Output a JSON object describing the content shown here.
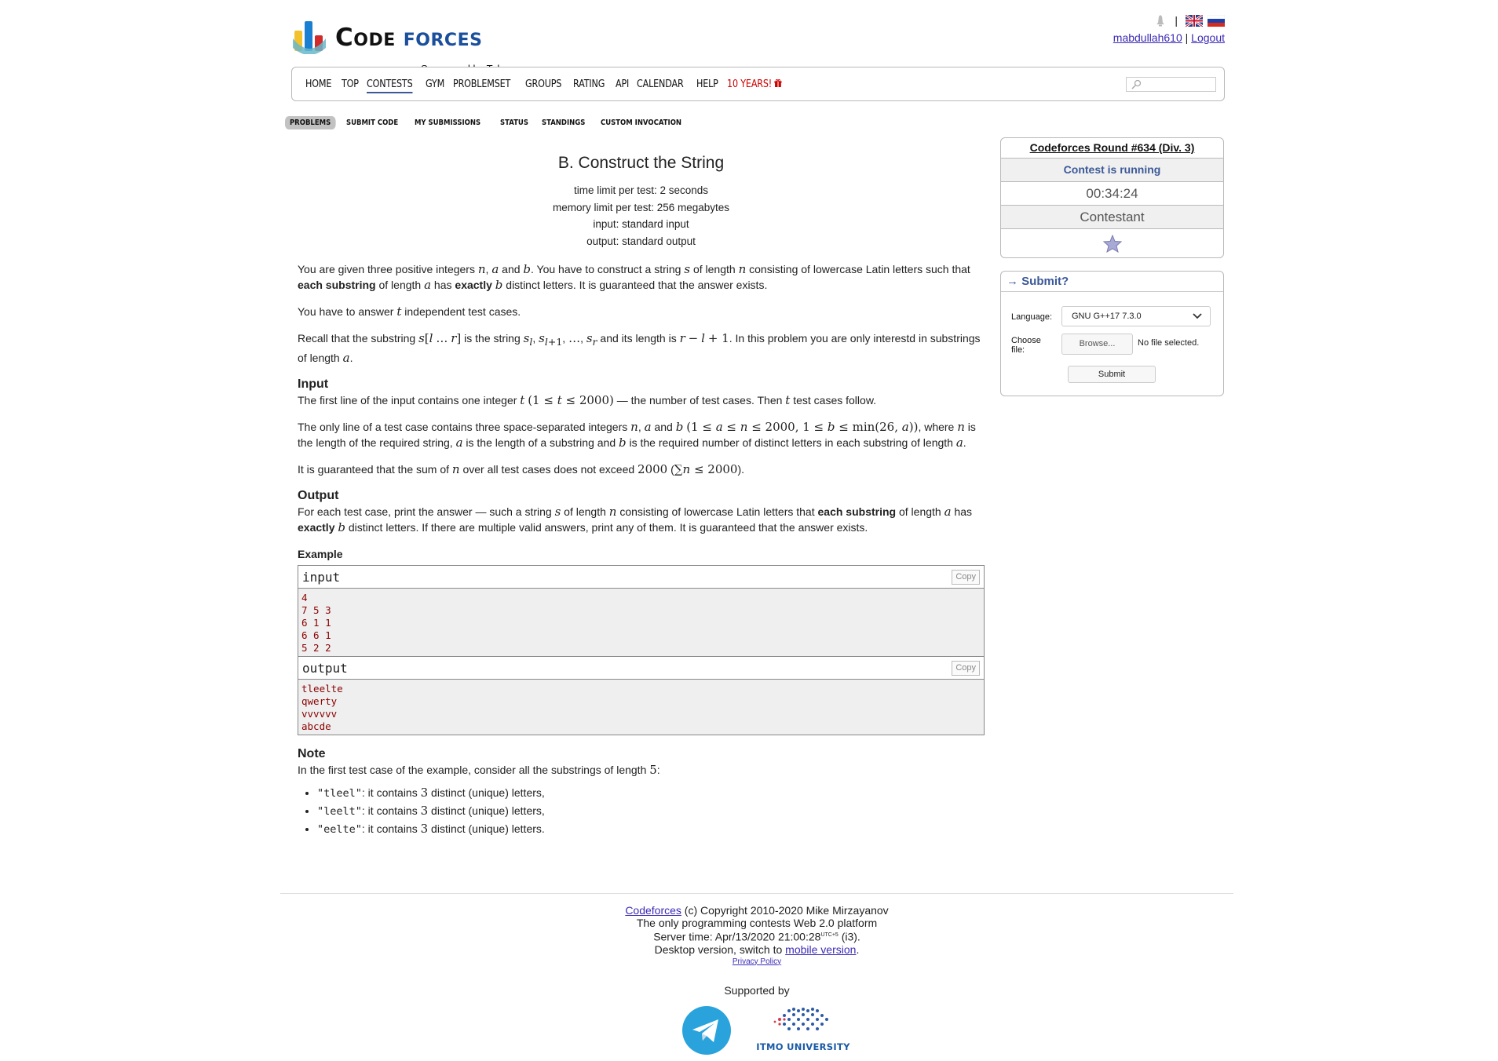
{
  "header": {
    "logo_word1": "Code",
    "logo_word2": "forces",
    "sponsor": "Sponsored by Telegram",
    "username": "mabdullah610",
    "separator": "|",
    "logout": "Logout"
  },
  "menu": {
    "items": [
      "HOME",
      "TOP",
      "CONTESTS",
      "GYM",
      "PROBLEMSET",
      "GROUPS",
      "RATING",
      "API",
      "CALENDAR",
      "HELP",
      "10 YEARS!"
    ],
    "active": "CONTESTS",
    "search_placeholder": ""
  },
  "submenu": {
    "items": [
      "PROBLEMS",
      "SUBMIT CODE",
      "MY SUBMISSIONS",
      "STATUS",
      "STANDINGS",
      "CUSTOM INVOCATION"
    ],
    "current": "PROBLEMS"
  },
  "problem": {
    "title": "B. Construct the String",
    "time_limit": "time limit per test: 2 seconds",
    "memory_limit": "memory limit per test: 256 megabytes",
    "input_file": "input: standard input",
    "output_file": "output: standard output",
    "input_heading": "Input",
    "output_heading": "Output",
    "example_heading": "Example",
    "note_heading": "Note"
  },
  "sample": {
    "input_label": "input",
    "output_label": "output",
    "copy_label": "Copy",
    "input_text": "4\n7 5 3\n6 1 1\n6 6 1\n5 2 2",
    "output_text": "tleelte\nqwerty\nvvvvvv\nabcde"
  },
  "note": {
    "intro_pre": "In the first test case of the example, consider all the substrings of length ",
    "intro_num": "5",
    "intro_post": ":",
    "items": [
      {
        "code": "\"tleel\"",
        "count": "3",
        "text": ": it contains ",
        "tail": " distinct (unique) letters,"
      },
      {
        "code": "\"leelt\"",
        "count": "3",
        "text": ": it contains ",
        "tail": " distinct (unique) letters,"
      },
      {
        "code": "\"eelte\"",
        "count": "3",
        "text": ": it contains ",
        "tail": " distinct (unique) letters."
      }
    ]
  },
  "sidebar": {
    "contest_name": "Codeforces Round #634 (Div. 3)",
    "contest_status": "Contest is running",
    "timer": "00:34:24",
    "role": "Contestant",
    "submit_caption": "→ Submit?",
    "language_label": "Language:",
    "language_value": "GNU G++17 7.3.0",
    "choose_file_label": "Choose file:",
    "browse_label": "Browse...",
    "no_file": "No file selected.",
    "submit_label": "Submit"
  },
  "footer": {
    "codeforces_link": "Codeforces",
    "copyright": " (c) Copyright 2010-2020 Mike Mirzayanov",
    "tagline": "The only programming contests Web 2.0 platform",
    "server_time_pre": "Server time: Apr/13/2020 21:00:28",
    "server_time_tz": "UTC+5",
    "server_time_post": " (i3).",
    "desktop_pre": "Desktop version, switch to ",
    "mobile_link": "mobile version",
    "desktop_post": ".",
    "privacy": "Privacy Policy",
    "supported_by": "Supported by",
    "itmo": "ITMO UNIVERSITY"
  },
  "colors": {
    "accent": "#3b5998",
    "sample_text": "#8b0000",
    "ten_years": "#cc0000"
  }
}
